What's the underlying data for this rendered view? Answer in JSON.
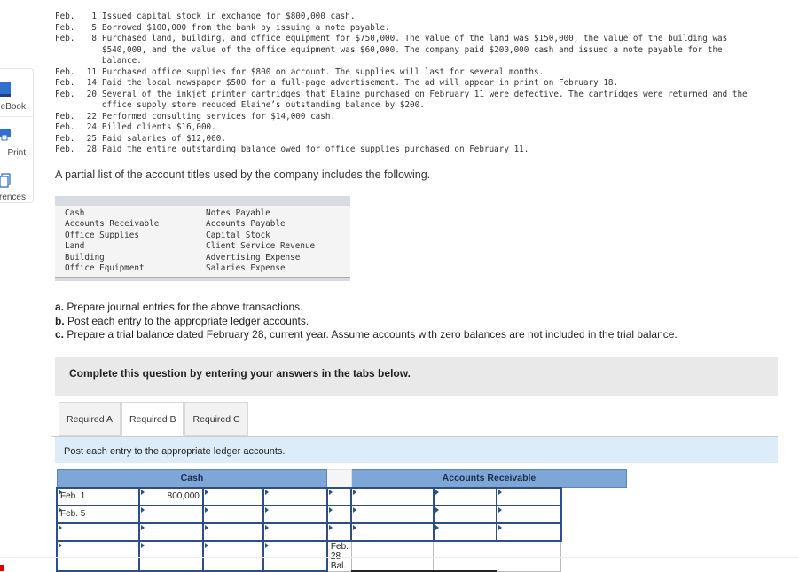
{
  "sidebar": {
    "items": [
      {
        "label": "eBook",
        "icon": "book-icon"
      },
      {
        "label": "Print",
        "icon": "printer-icon"
      },
      {
        "label": "References",
        "icon": "copy-icon"
      }
    ]
  },
  "transactions": [
    {
      "month": "Feb.",
      "day": "1",
      "text": "Issued capital stock in exchange for $800,000 cash."
    },
    {
      "month": "Feb.",
      "day": "5",
      "text": "Borrowed $100,000 from the bank by issuing a note payable."
    },
    {
      "month": "Feb.",
      "day": "8",
      "text": "Purchased land, building, and office equipment for $750,000. The value of the land was $150,000, the value of the building was $540,000, and the value of the office equipment was $60,000. The company paid $200,000 cash and issued a note payable for the balance."
    },
    {
      "month": "Feb.",
      "day": "11",
      "text": "Purchased office supplies for $800 on account. The supplies will last for several months."
    },
    {
      "month": "Feb.",
      "day": "14",
      "text": "Paid the local newspaper $500 for a full-page advertisement. The ad will appear in print on February 18."
    },
    {
      "month": "Feb.",
      "day": "20",
      "text": "Several of the inkjet printer cartridges that Elaine purchased on February 11 were defective. The cartridges were returned and the office supply store reduced Elaine’s outstanding balance by $200."
    },
    {
      "month": "Feb.",
      "day": "22",
      "text": "Performed consulting services for $14,000 cash."
    },
    {
      "month": "Feb.",
      "day": "24",
      "text": "Billed clients $16,000."
    },
    {
      "month": "Feb.",
      "day": "25",
      "text": "Paid salaries of $12,000."
    },
    {
      "month": "Feb.",
      "day": "28",
      "text": "Paid the entire outstanding balance owed for office supplies purchased on February 11."
    }
  ],
  "intro": "A partial list of the account titles used by the company includes the following.",
  "accounts": {
    "left": [
      "Cash",
      "Accounts Receivable",
      "Office Supplies",
      "Land",
      "Building",
      "Office Equipment"
    ],
    "right": [
      "Notes Payable",
      "Accounts Payable",
      "Capital Stock",
      "Client Service Revenue",
      "Advertising Expense",
      "Salaries Expense"
    ]
  },
  "requirements": [
    {
      "letter": "a.",
      "text": "Prepare journal entries for the above transactions."
    },
    {
      "letter": "b.",
      "text": "Post each entry to the appropriate ledger accounts."
    },
    {
      "letter": "c.",
      "text": "Prepare a trial balance dated February 28, current year. Assume accounts with zero balances are not included in the trial balance."
    }
  ],
  "instruction_box": "Complete this question by entering your answers in the tabs below.",
  "tabs": [
    {
      "label": "Required A",
      "active": false
    },
    {
      "label": "Required B",
      "active": true
    },
    {
      "label": "Required C",
      "active": false
    }
  ],
  "tab_instruction": "Post each entry to the appropriate ledger accounts.",
  "ledger": {
    "cash": {
      "title": "Cash",
      "rows": [
        [
          "Feb. 1",
          "800,000",
          "",
          ""
        ],
        [
          "Feb. 5",
          "",
          "",
          ""
        ],
        [
          "",
          "",
          "",
          ""
        ],
        [
          "",
          "",
          "",
          ""
        ]
      ]
    },
    "ar": {
      "title": "Accounts Receivable",
      "rows": [
        [
          "",
          "",
          "",
          ""
        ],
        [
          "",
          "",
          "",
          ""
        ],
        [
          "",
          "",
          "",
          ""
        ]
      ],
      "balance_label": "Feb. 28 Bal."
    }
  }
}
